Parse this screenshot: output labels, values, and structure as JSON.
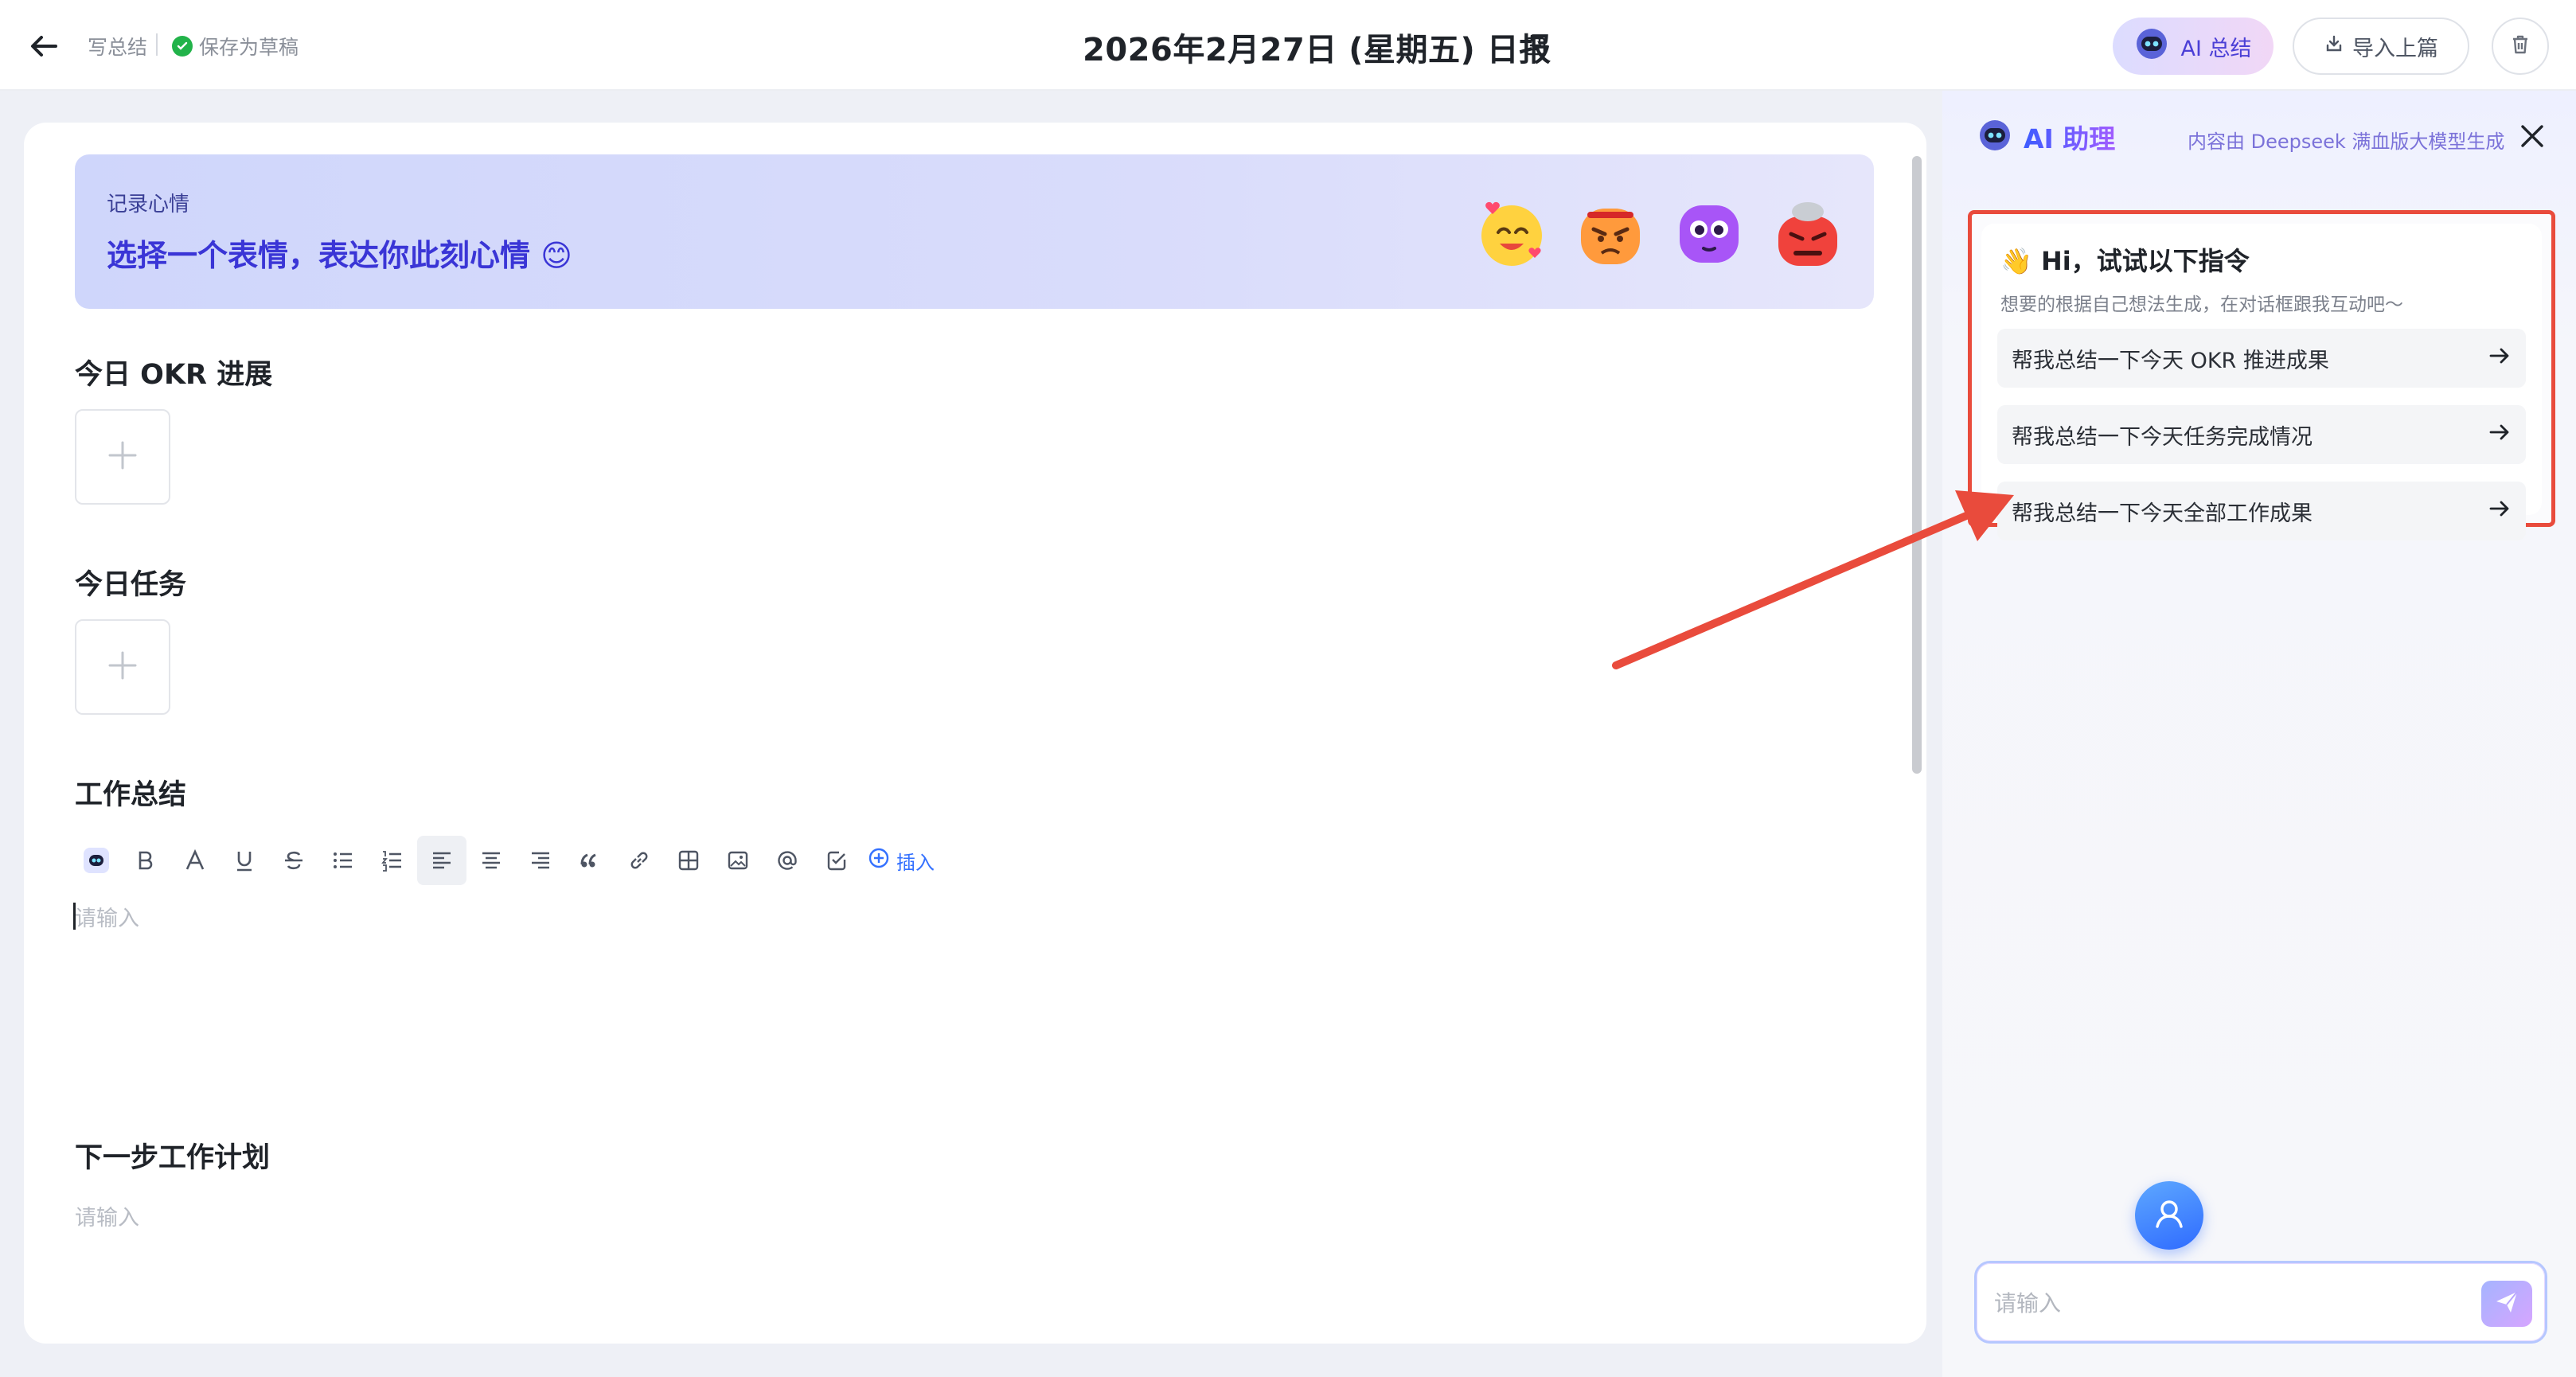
{
  "header": {
    "crumb": "写总结",
    "save_status": "保存为草稿",
    "title": "2026年2月27日 (星期五) 日报",
    "ai_summary_label": "AI 总结",
    "import_label": "导入上篇"
  },
  "mood": {
    "label": "记录心情",
    "prompt": "选择一个表情，表达你此刻心情 😊",
    "emojis": [
      "emoji-in-love",
      "emoji-angry",
      "emoji-purple-face",
      "emoji-furious"
    ]
  },
  "sections": {
    "okr": "今日 OKR 进展",
    "tasks": "今日任务",
    "summary": "工作总结",
    "next_plan": "下一步工作计划"
  },
  "editor": {
    "insert_label": "插入",
    "summary_placeholder": "请输入",
    "plan_placeholder": "请输入"
  },
  "ai_panel": {
    "title": "AI 助理",
    "note": "内容由 Deepseek 满血版大模型生成",
    "greeting": "👋 Hi，试试以下指令",
    "subtitle": "想要的根据自己想法生成，在对话框跟我互动吧～",
    "commands": [
      "帮我总结一下今天 OKR 推进成果",
      "帮我总结一下今天任务完成情况",
      "帮我总结一下今天全部工作成果"
    ],
    "input_placeholder": "请输入"
  },
  "colors": {
    "accent": "#3a35d6",
    "annotation": "#e94b3c",
    "success": "#22b34a"
  }
}
